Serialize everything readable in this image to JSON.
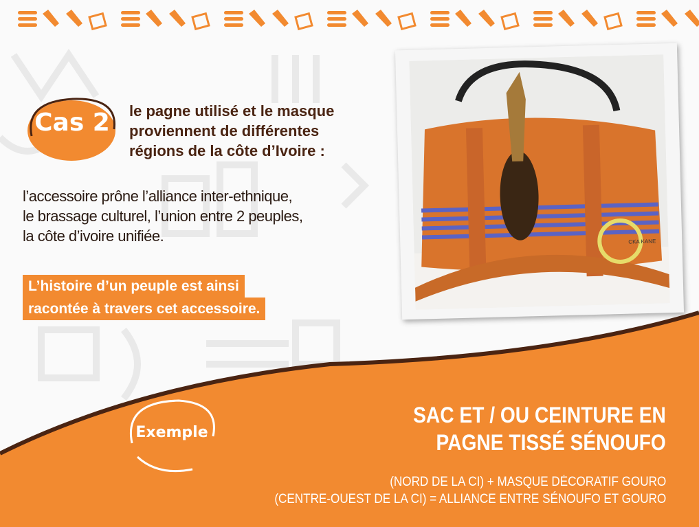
{
  "colors": {
    "orange": "#f28a30",
    "brown": "#4a2412",
    "background": "#fafafa"
  },
  "badge": {
    "label": "Cas 2"
  },
  "heading": {
    "lines": [
      "le pagne utilisé et le masque",
      "proviennent de différentes",
      "régions de la côte d’Ivoire :"
    ]
  },
  "body": {
    "lines": [
      "l’accessoire prône l’alliance inter-ethnique,",
      "le brassage culturel, l’union entre 2 peuples,",
      "la côte d’ivoire unifiée."
    ]
  },
  "highlight": {
    "lines": [
      "L’histoire d’un peuple est ainsi",
      "racontée à travers cet accessoire."
    ]
  },
  "photo": {
    "watermark": "CKA KANE",
    "subject": "orange woven bag with mask"
  },
  "example": {
    "badge": "Exemple",
    "title_lines": [
      "SAC ET / OU CEINTURE EN",
      "PAGNE TISSÉ SÉNOUFO"
    ],
    "subtitle_lines": [
      "(NORD DE LA CI) + MASQUE DÉCORATIF GOURO",
      "(CENTRE-OUEST DE LA CI) = ALLIANCE ENTRE SÉNOUFO ET GOURO"
    ]
  }
}
